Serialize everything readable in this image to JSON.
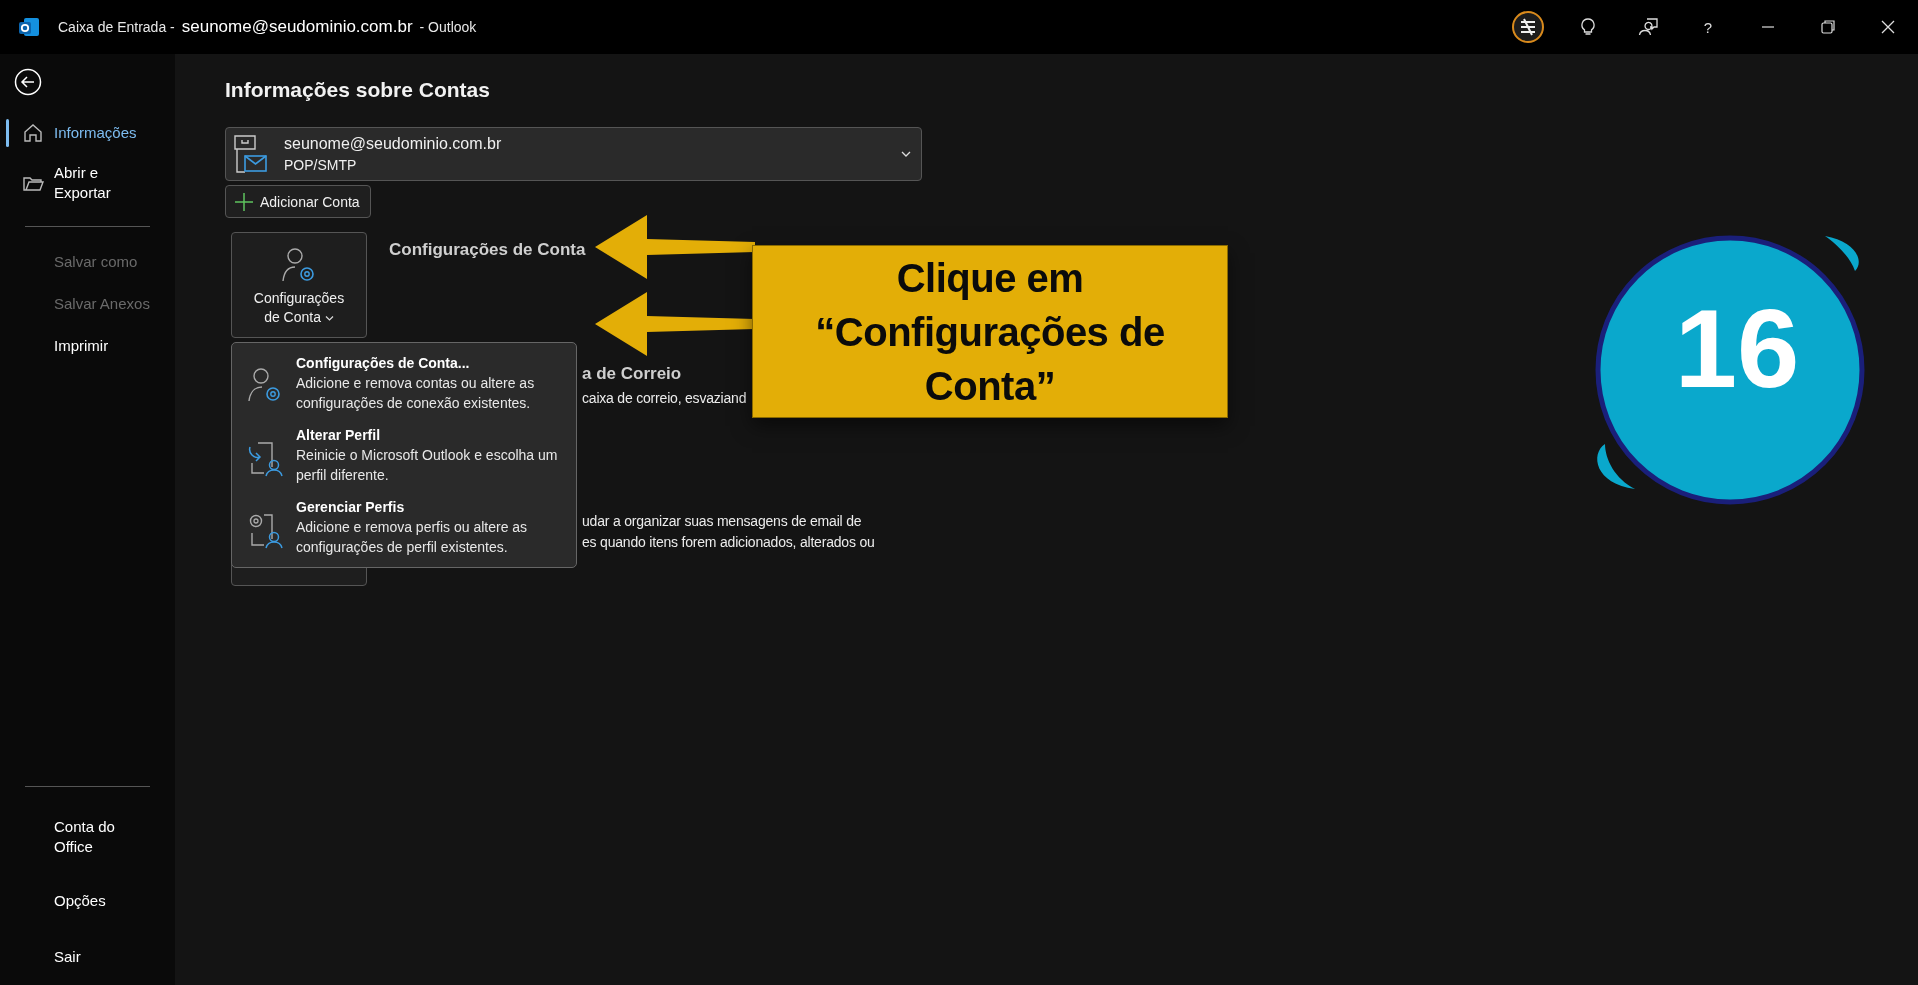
{
  "title_bar": {
    "title_parts": [
      {
        "text": "Caixa de Entrada -",
        "kind": "normal"
      },
      {
        "text": "seunome@seudominio.com.br",
        "kind": "large"
      },
      {
        "text": "-  Outlook",
        "kind": "normal"
      }
    ],
    "help_label": "?"
  },
  "sidebar": {
    "groups": [
      {
        "items": [
          {
            "label": "Informações",
            "kind": "home",
            "selected": true,
            "disabled": false
          },
          {
            "label": "Abrir e Exportar",
            "kind": "folder",
            "selected": false,
            "disabled": false
          }
        ]
      },
      {
        "items": [
          {
            "label": "Salvar como",
            "kind": "plain",
            "selected": false,
            "disabled": true
          },
          {
            "label": "Salvar Anexos",
            "kind": "plain",
            "selected": false,
            "disabled": true
          },
          {
            "label": "Imprimir",
            "kind": "plain",
            "selected": false,
            "disabled": false
          }
        ]
      },
      {
        "items": [
          {
            "label": "Conta do Office",
            "kind": "plain",
            "selected": false,
            "disabled": false
          },
          {
            "label": "Opções",
            "kind": "plain",
            "selected": false,
            "disabled": false
          },
          {
            "label": "Sair",
            "kind": "plain",
            "selected": false,
            "disabled": false
          }
        ]
      }
    ]
  },
  "main": {
    "title": "Informações sobre Contas",
    "account": {
      "email": "seunome@seudominio.com.br",
      "type": "POP/SMTP"
    },
    "add_account": "Adicionar Conta",
    "sections": [
      {
        "tile": true,
        "tile_label": "Configurações de Conta",
        "heading": "Configurações de Conta"
      },
      {
        "heading": "a de Correio",
        "lines": [
          "caixa de correio, esvaziand"
        ]
      },
      {
        "tile": true,
        "lines": [
          "udar a organizar suas mensagens de email de",
          "es quando itens forem adicionados, alterados ou"
        ]
      }
    ]
  },
  "account_menu": {
    "items": [
      {
        "kind": "account-settings",
        "title": "Configurações de Conta...",
        "description": "Adicione e remova contas ou altere as configurações de conexão existentes."
      },
      {
        "kind": "change-profile",
        "title": "Alterar Perfil",
        "description": "Reinicie o Microsoft Outlook e escolha um perfil diferente."
      },
      {
        "kind": "manage-profiles",
        "title": "Gerenciar Perfis",
        "description": "Adicione e remova perfis ou altere as configurações de perfil existentes."
      }
    ]
  },
  "callout": {
    "lines": [
      "Clique em",
      "“Configurações de",
      "Conta”"
    ]
  },
  "step_badge": {
    "number": "16"
  }
}
